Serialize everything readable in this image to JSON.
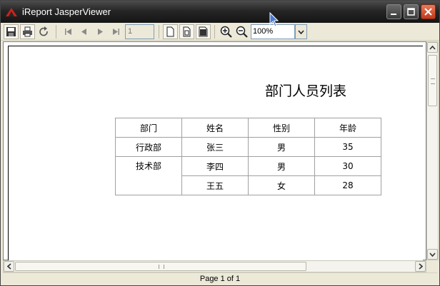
{
  "window": {
    "title": "iReport JasperViewer"
  },
  "toolbar": {
    "page_number": "1",
    "zoom_value": "100%",
    "icons": [
      "save-icon",
      "print-icon",
      "reload-icon",
      "first-page-icon",
      "previous-page-icon",
      "next-page-icon",
      "last-page-icon",
      "actual-size-icon",
      "fit-page-icon",
      "fit-width-icon",
      "zoom-in-icon",
      "zoom-out-icon"
    ]
  },
  "report": {
    "title": "部门人员列表",
    "columns": [
      "部门",
      "姓名",
      "性别",
      "年龄"
    ],
    "rows": [
      {
        "dept": "行政部",
        "name": "张三",
        "gender": "男",
        "age": "35"
      },
      {
        "dept": "技术部",
        "name": "李四",
        "gender": "男",
        "age": "30"
      },
      {
        "dept": "",
        "name": "王五",
        "gender": "女",
        "age": "28"
      }
    ]
  },
  "status": {
    "page_info": "Page 1 of 1"
  },
  "colors": {
    "titlebar": "#262626",
    "close_button": "#c0391b",
    "window_bg": "#ece9d8"
  }
}
